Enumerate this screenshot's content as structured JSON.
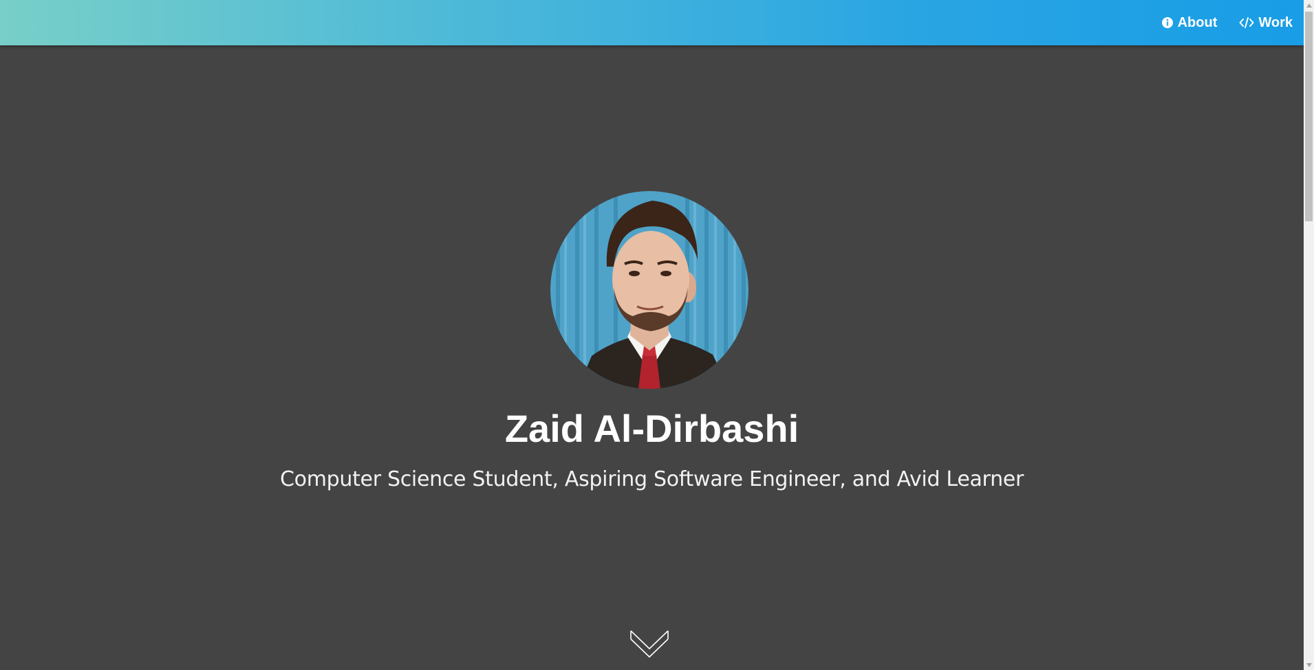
{
  "nav": {
    "items": [
      {
        "label": "About",
        "icon": "info-circle-icon"
      },
      {
        "label": "Work",
        "icon": "code-icon"
      }
    ]
  },
  "hero": {
    "name": "Zaid Al-Dirbashi",
    "tagline": "Computer Science Student, Aspiring Software Engineer, and Avid Learner",
    "avatar_alt": "profile photo",
    "scroll_icon": "chevron-down-icon"
  },
  "colors": {
    "background": "#444444",
    "nav_gradient_start": "#78cfc8",
    "nav_gradient_end": "#189de6",
    "text": "#ffffff"
  }
}
